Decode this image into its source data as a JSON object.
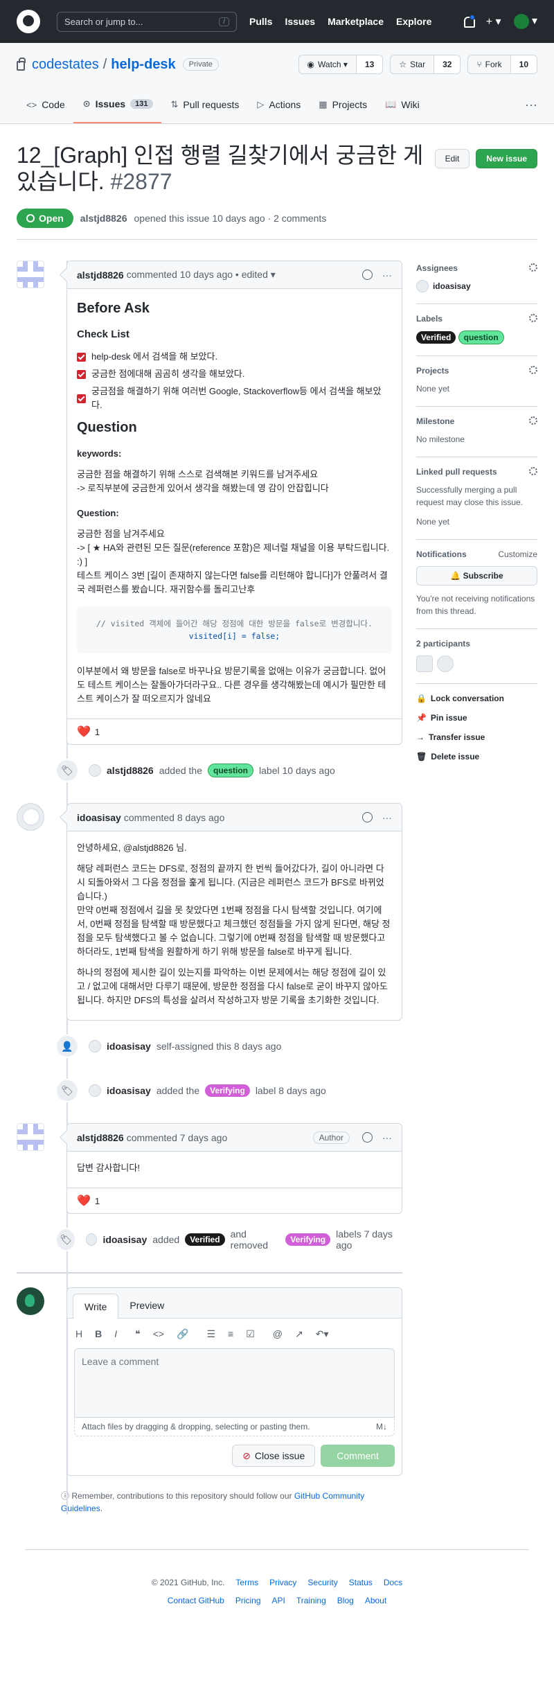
{
  "header": {
    "search_placeholder": "Search or jump to...",
    "slash": "/",
    "nav": [
      "Pulls",
      "Issues",
      "Marketplace",
      "Explore"
    ],
    "plus": "+ ▾",
    "avatar_caret": "▾"
  },
  "repo": {
    "owner": "codestates",
    "name": "help-desk",
    "visibility": "Private",
    "watch": {
      "label": "Watch ▾",
      "count": "13"
    },
    "star": {
      "label": "Star",
      "count": "32"
    },
    "fork": {
      "label": "Fork",
      "count": "10"
    }
  },
  "tabs": [
    {
      "label": "Code",
      "icon": "<>"
    },
    {
      "label": "Issues",
      "icon": "⊙",
      "count": "131"
    },
    {
      "label": "Pull requests",
      "icon": "⇅"
    },
    {
      "label": "Actions",
      "icon": "▷"
    },
    {
      "label": "Projects",
      "icon": "▦"
    },
    {
      "label": "Wiki",
      "icon": "📖"
    }
  ],
  "more": "···",
  "issue": {
    "title": "12_[Graph] 인접 행렬 길찾기에서 궁금한 게 있습니다.",
    "number": "#2877",
    "edit": "Edit",
    "new": "New issue",
    "state": "Open",
    "author": "alstjd8826",
    "meta": "opened this issue 10 days ago · 2 comments"
  },
  "c1": {
    "author": "alstjd8826",
    "meta": "commented 10 days ago • edited ▾",
    "h_before": "Before Ask",
    "h_check": "Check List",
    "checks": [
      "help-desk 에서 검색을 해 보았다.",
      "궁금한 점에대해 곰곰히 생각을 해보았다.",
      "궁금점을 해결하기 위해 여러번 Google, Stackoverflow등 에서 검색을 해보았다."
    ],
    "h_question": "Question",
    "h_keywords": "keywords:",
    "p_keywords1": "궁금한 점을 해결하기 위해 스스로 검색해본 키워드를 남겨주세요",
    "p_keywords2": "-> 로직부분에 궁금한게 있어서 생각을 해봤는데 영 감이 안잡힙니다",
    "h_q": "Question:",
    "p_q1": "궁금한 점을 남겨주세요",
    "p_q2": "-> [ ★ HA와 관련된 모든 질문(reference 포함)은 제너럴 채널을 이용 부탁드립니다. :) ]",
    "p_q3": "테스트 케이스 3번 [길이 존재하지 않는다면 false를 리턴해야 합니다]가 안풀려서 결국 레퍼런스를 봤습니다. 재귀함수를 돌리고난후",
    "code_comment": "// visited 객체에 들어간 해당 정점에 대한 방문을 false로 변경합니다.",
    "code_line": "visited[i] = false;",
    "p_last": "이부분에서 왜 방문을 false로 바꾸나요 방문기록을 없애는 이유가 궁금합니다. 없어도 테스트 케이스는 잘돌아가더라구요.. 다른 경우를 생각해봤는데 예시가 필만한 테스트 케이스가 잘 떠오르지가 않네요",
    "reaction": "1"
  },
  "e1": {
    "actor": "alstjd8826",
    "pre": "added the",
    "label": "question",
    "post": "label 10 days ago"
  },
  "c2": {
    "author": "idoasisay",
    "meta": "commented 8 days ago",
    "p1": "안녕하세요, @alstjd8826 님.",
    "p2": "해당 레퍼런스 코드는 DFS로, 정점의 끝까지 한 번씩 들어갔다가, 길이 아니라면 다시 되돌아와서 그 다음 정점을 훑게 됩니다. (지금은 레퍼런스 코드가 BFS로 바뀌었습니다.)",
    "p3": "만약 0번째 정점에서 길을 못 찾았다면 1번째 정점을 다시 탐색할 것입니다. 여기에서, 0번째 정점을 탐색할 때 방문했다고 체크했던 정점들을 가지 않게 된다면, 해당 정점을 모두 탐색했다고 볼 수 없습니다. 그렇기에 0번째 정점을 탐색할 때 방문했다고 하더라도, 1번째 탐색을 원활하게 하기 위해 방문을 false로 바꾸게 됩니다.",
    "p4": "하나의 정점에 제시한 길이 있는지를 파악하는 이번 문제에서는 해당 정점에 길이 있고 / 없고에 대해서만 다루기 때문에, 방문한 정점을 다시 false로 굳이 바꾸지 않아도 됩니다. 하지만 DFS의 특성을 살려서 작성하고자 방문 기록을 초기화한 것입니다."
  },
  "e2": {
    "actor": "idoasisay",
    "text": "self-assigned this 8 days ago"
  },
  "e3": {
    "actor": "idoasisay",
    "pre": "added the",
    "label": "Verifying",
    "post": "label 8 days ago"
  },
  "c3": {
    "author": "alstjd8826",
    "meta": "commented 7 days ago",
    "badge": "Author",
    "body": "답변 감사합니다!",
    "reaction": "1"
  },
  "e4": {
    "actor": "idoasisay",
    "pre": "added",
    "label1": "Verified",
    "mid": "and removed",
    "label2": "Verifying",
    "post": "labels 7 days ago"
  },
  "compose": {
    "tab_write": "Write",
    "tab_preview": "Preview",
    "placeholder": "Leave a comment",
    "attach": "Attach files by dragging & dropping, selecting or pasting them.",
    "close": "Close issue",
    "comment": "Comment",
    "note_pre": "Remember, contributions to this repository should follow our",
    "note_link": "GitHub Community Guidelines",
    "note_post": "."
  },
  "sidebar": {
    "assignees": {
      "title": "Assignees",
      "value": "idoasisay"
    },
    "labels": {
      "title": "Labels",
      "l1": "Verified",
      "l2": "question"
    },
    "projects": {
      "title": "Projects",
      "value": "None yet"
    },
    "milestone": {
      "title": "Milestone",
      "value": "No milestone"
    },
    "linked": {
      "title": "Linked pull requests",
      "desc": "Successfully merging a pull request may close this issue.",
      "value": "None yet"
    },
    "notif": {
      "title": "Notifications",
      "customize": "Customize",
      "button": "Subscribe",
      "desc": "You're not receiving notifications from this thread."
    },
    "participants": "2 participants",
    "actions": [
      "Lock conversation",
      "Pin issue",
      "Transfer issue",
      "Delete issue"
    ]
  },
  "footer": {
    "copy": "© 2021 GitHub, Inc.",
    "row1": [
      "Terms",
      "Privacy",
      "Security",
      "Status",
      "Docs"
    ],
    "row2": [
      "Contact GitHub",
      "Pricing",
      "API",
      "Training",
      "Blog",
      "About"
    ]
  },
  "colors": {
    "open": "#2da44e",
    "accent": "#0969da",
    "tab_underline": "#fd8c73"
  }
}
